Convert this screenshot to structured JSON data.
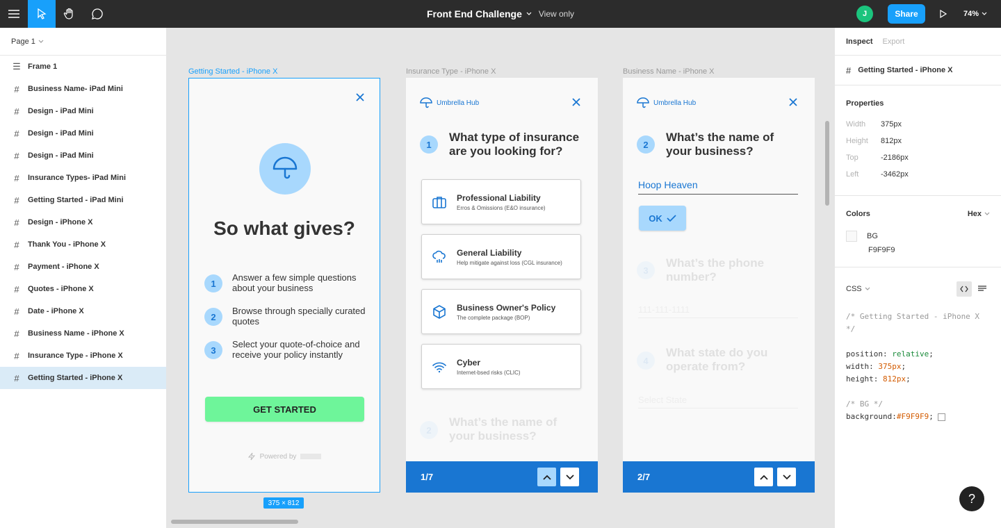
{
  "topbar": {
    "title": "Front End Challenge",
    "view_mode": "View only",
    "avatar_initial": "J",
    "share_label": "Share",
    "zoom": "74%"
  },
  "left_panel": {
    "page": "Page 1",
    "layers": [
      {
        "label": "Frame 1",
        "icon": "frame-icon"
      },
      {
        "label": "Business Name- iPad Mini",
        "icon": "hash-icon"
      },
      {
        "label": "Design - iPad Mini",
        "icon": "hash-icon"
      },
      {
        "label": "Design - iPad Mini",
        "icon": "hash-icon"
      },
      {
        "label": "Design - iPad Mini",
        "icon": "hash-icon"
      },
      {
        "label": "Insurance Types- iPad Mini",
        "icon": "hash-icon"
      },
      {
        "label": "Getting Started - iPad Mini",
        "icon": "hash-icon"
      },
      {
        "label": "Design - iPhone X",
        "icon": "hash-icon"
      },
      {
        "label": "Thank You - iPhone X",
        "icon": "hash-icon"
      },
      {
        "label": "Payment - iPhone X",
        "icon": "hash-icon"
      },
      {
        "label": "Quotes - iPhone X",
        "icon": "hash-icon"
      },
      {
        "label": "Date - iPhone X",
        "icon": "hash-icon"
      },
      {
        "label": "Business Name - iPhone X",
        "icon": "hash-icon"
      },
      {
        "label": "Insurance Type - iPhone X",
        "icon": "hash-icon"
      },
      {
        "label": "Getting Started - iPhone X",
        "icon": "hash-icon",
        "selected": true
      }
    ]
  },
  "canvas": {
    "frame_labels": [
      "Getting Started - iPhone X",
      "Insurance Type - iPhone X",
      "Business Name - iPhone X"
    ],
    "size_badge": "375 × 812",
    "getting_started": {
      "heading": "So what gives?",
      "steps": [
        {
          "num": "1",
          "text": "Answer a few simple questions about your business"
        },
        {
          "num": "2",
          "text": "Browse through specially curated quotes"
        },
        {
          "num": "3",
          "text": "Select your quote-of-choice and receive your policy instantly"
        }
      ],
      "cta": "GET STARTED",
      "powered_by": "Powered by"
    },
    "insurance_type": {
      "brand": "Umbrella Hub",
      "q_num": "1",
      "question": "What type of insurance are you looking for?",
      "options": [
        {
          "title": "Professional Liability",
          "sub": "Erros & Omissions (E&O insurance)",
          "icon": "briefcase-icon"
        },
        {
          "title": "General Liability",
          "sub": "Help mitigate against loss (CGL insurance)",
          "icon": "cloud-rain-icon"
        },
        {
          "title": "Business Owner's Policy",
          "sub": "The complete package (BOP)",
          "icon": "package-icon"
        },
        {
          "title": "Cyber",
          "sub": "Internet-bsed risks (CLIC)",
          "icon": "wifi-icon"
        }
      ],
      "next_q_num": "2",
      "next_question": "What’s the name of your business?",
      "progress": "1/7"
    },
    "business_name": {
      "brand": "Umbrella Hub",
      "q_num": "2",
      "question": "What’s the name of your business?",
      "answer": "Hoop Heaven",
      "ok_label": "OK",
      "q3_num": "3",
      "q3": "What’s the phone number?",
      "q3_placeholder": "111-111-1111",
      "q4_num": "4",
      "q4": "What state do you operate from?",
      "q4_placeholder": "Select State",
      "progress": "2/7"
    }
  },
  "right_panel": {
    "tabs": [
      "Inspect",
      "Export"
    ],
    "selection": "Getting Started - iPhone X",
    "properties_heading": "Properties",
    "properties": [
      {
        "k": "Width",
        "v": "375px"
      },
      {
        "k": "Height",
        "v": "812px"
      },
      {
        "k": "Top",
        "v": "-2186px"
      },
      {
        "k": "Left",
        "v": "-3462px"
      }
    ],
    "colors_heading": "Colors",
    "color_format": "Hex",
    "color_name": "BG",
    "color_value": "F9F9F9",
    "css_heading": "CSS",
    "css_code": {
      "comment1": "/* Getting Started - iPhone X */",
      "pos_k": "position: ",
      "pos_v": "relative",
      "w_k": "width: ",
      "w_v": "375px",
      "h_k": "height: ",
      "h_v": "812px",
      "comment2": "/* BG */",
      "bg_k": "background: ",
      "bg_v": "#F9F9F9"
    }
  },
  "help_label": "?",
  "colors": {
    "accent": "#18a0fb",
    "primary": "#1976d2",
    "light_blue": "#a8d8fd",
    "green": "#6ef59a"
  }
}
